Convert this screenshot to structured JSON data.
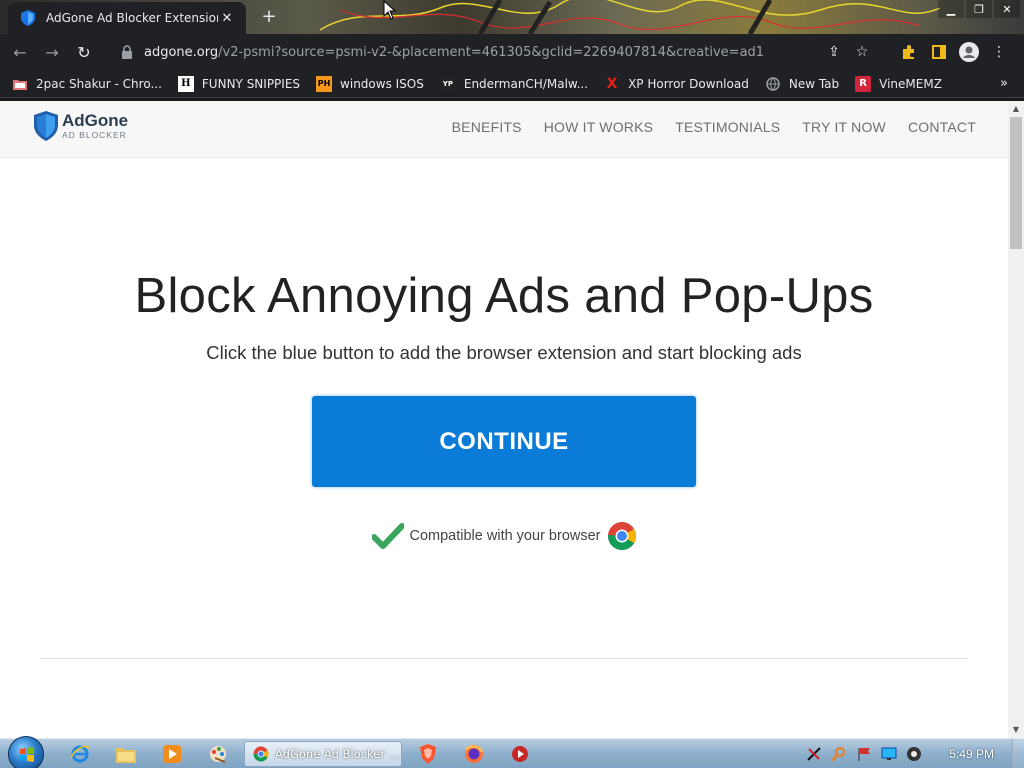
{
  "browser": {
    "tab_title": "AdGone Ad Blocker Extension",
    "new_tab_symbol": "+",
    "url_host": "adgone.org",
    "url_rest": "/v2-psmi?source=psmi-v2-&placement=461305&gclid=2269407814&creative=ad1",
    "bookmarks": [
      {
        "label": "2pac Shakur - Chro...",
        "icon": "folder-icon",
        "icon_text": "",
        "color": "#e8eaed"
      },
      {
        "label": "FUNNY SNIPPIES",
        "icon": "h-icon",
        "icon_text": "H",
        "color": "#ffffff"
      },
      {
        "label": "windows ISOS",
        "icon": "ph-icon",
        "icon_text": "PH",
        "color": "#f7971d"
      },
      {
        "label": "EndermanCH/Malw...",
        "icon": "yp-icon",
        "icon_text": "YP",
        "color": "#e8eaed"
      },
      {
        "label": "XP Horror Download",
        "icon": "x-icon",
        "icon_text": "X",
        "color": "#e62117"
      },
      {
        "label": "New Tab",
        "icon": "globe-icon",
        "icon_text": "",
        "color": "#9aa0a6"
      },
      {
        "label": "VineMEMZ",
        "icon": "r-icon",
        "icon_text": "R",
        "color": "#d2263b"
      }
    ],
    "bookmarks_overflow": "»"
  },
  "site": {
    "brand": "AdGone",
    "brand_sub": "AD BLOCKER",
    "nav": [
      "BENEFITS",
      "HOW IT WORKS",
      "TESTIMONIALS",
      "TRY IT NOW",
      "CONTACT"
    ],
    "headline": "Block Annoying Ads and Pop-Ups",
    "subtitle": "Click the blue button to add the browser extension and start blocking ads",
    "cta_label": "CONTINUE",
    "compat_text": "Compatible with your browser",
    "accent_color": "#0a7bd6",
    "check_color": "#3aa55b"
  },
  "taskbar": {
    "active_window_label": "AdGone Ad Blocker ...",
    "clock": "5:49 PM",
    "pinned": [
      "internet-explorer-icon",
      "file-explorer-icon",
      "media-player-icon",
      "paint-icon"
    ],
    "after_active": [
      "brave-icon",
      "firefox-icon",
      "media-record-icon"
    ],
    "tray": [
      "no-network-icon",
      "search-tray-icon",
      "flag-icon",
      "display-icon",
      "volume-icon"
    ]
  }
}
